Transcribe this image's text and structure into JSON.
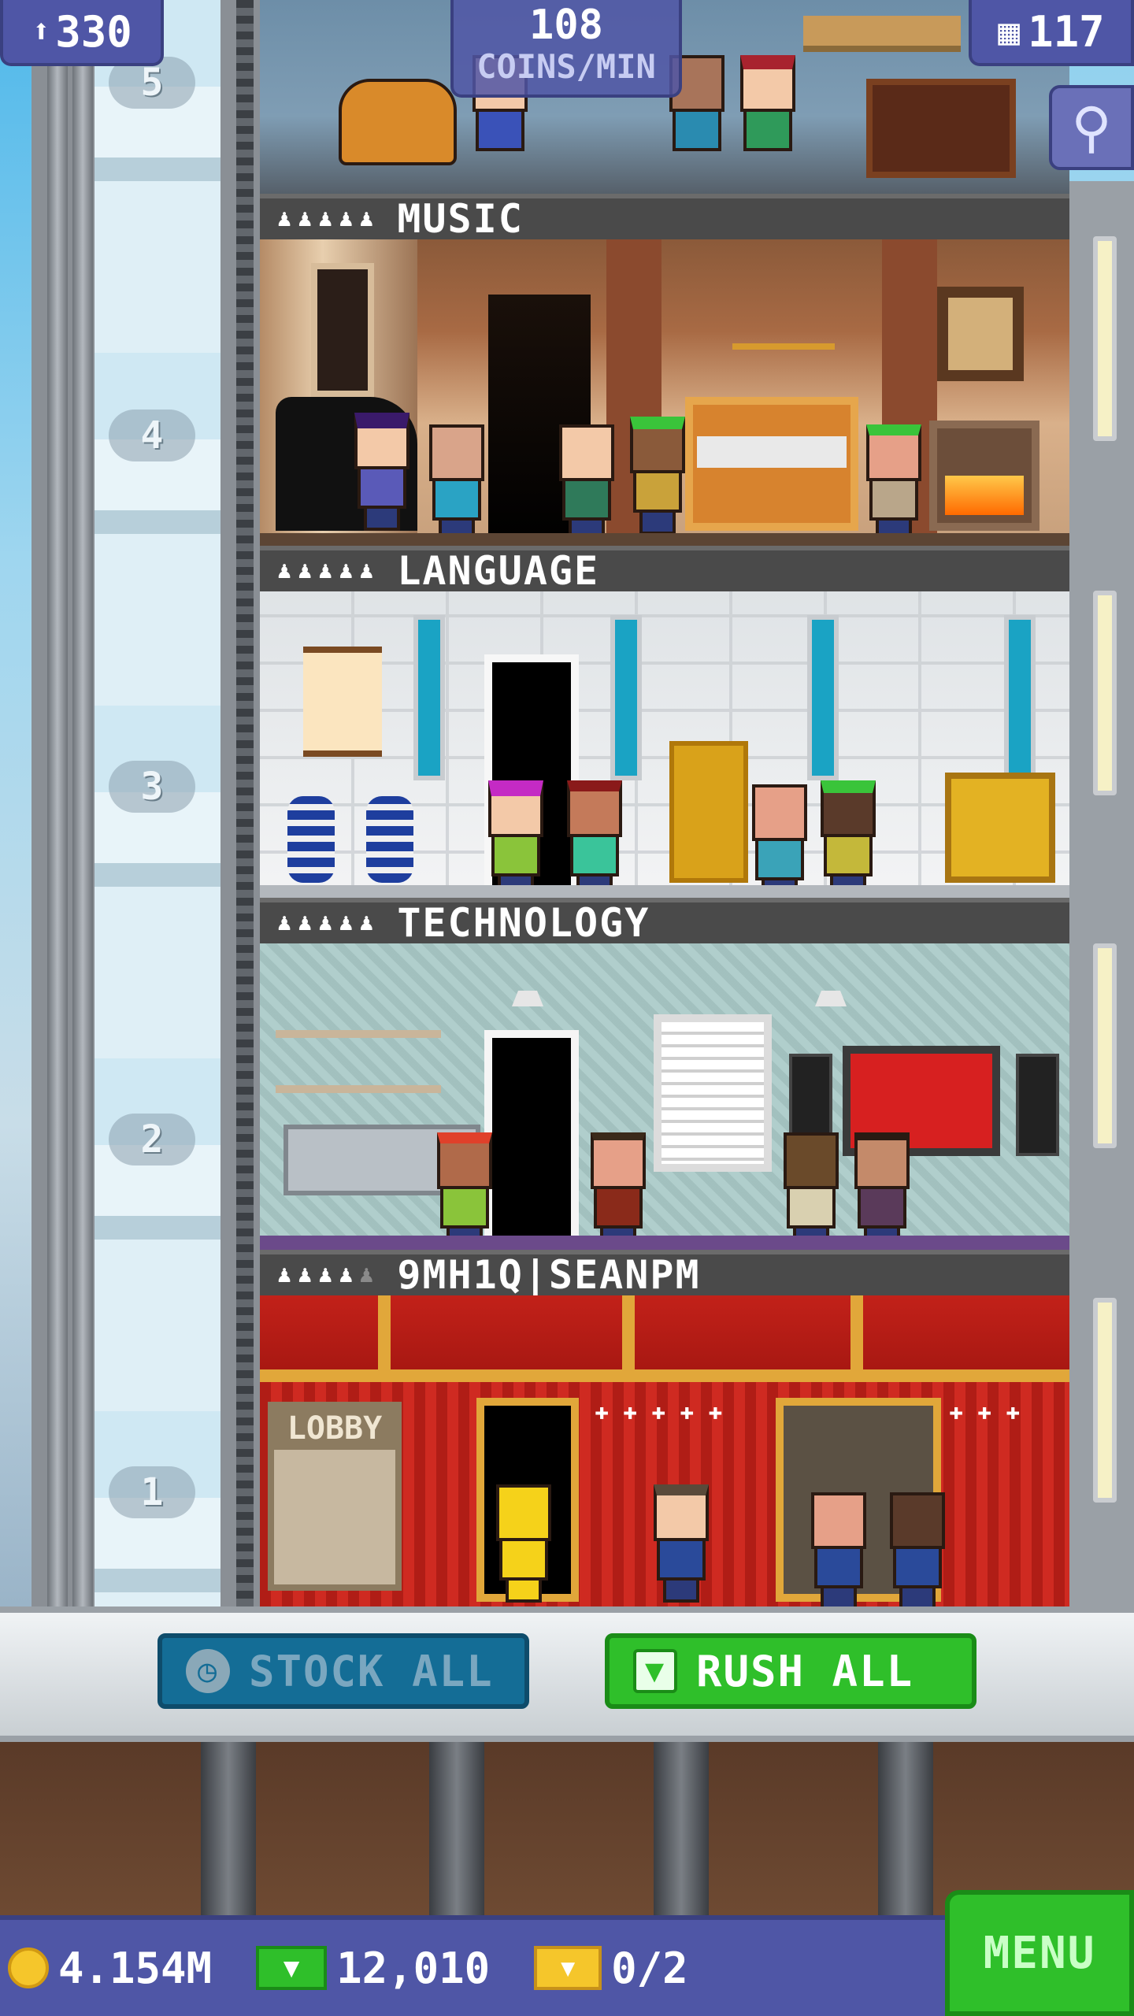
{
  "top_bar": {
    "population": "330",
    "population_icon": "person-up-icon",
    "coins_per_min_value": "108",
    "coins_per_min_label": "COINS/MIN",
    "floors": "117",
    "floors_icon": "building-icon",
    "search_icon": "magnifier-icon"
  },
  "elevator": {
    "floor_numbers": [
      "5",
      "4",
      "3",
      "2",
      "1"
    ]
  },
  "floors": [
    {
      "name": "MUSIC",
      "residents_filled": 5,
      "residents_total": 5
    },
    {
      "name": "LANGUAGE",
      "residents_filled": 5,
      "residents_total": 5
    },
    {
      "name": "TECHNOLOGY",
      "residents_filled": 5,
      "residents_total": 5
    },
    {
      "name": "9MH1Q|SEANPM",
      "residents_filled": 4,
      "residents_total": 5
    }
  ],
  "lobby": {
    "sign": "LOBBY"
  },
  "actions": {
    "stock_all": "STOCK ALL",
    "rush_all": "RUSH ALL"
  },
  "bottom_bar": {
    "coins": "4.154M",
    "bux": "12,010",
    "tickets": "0/2",
    "menu": "MENU"
  },
  "colors": {
    "ui_blue": "#4f56a6",
    "accent_green": "#2fbf2a",
    "stock_blue": "#146d96",
    "lobby_red": "#c0231c"
  }
}
